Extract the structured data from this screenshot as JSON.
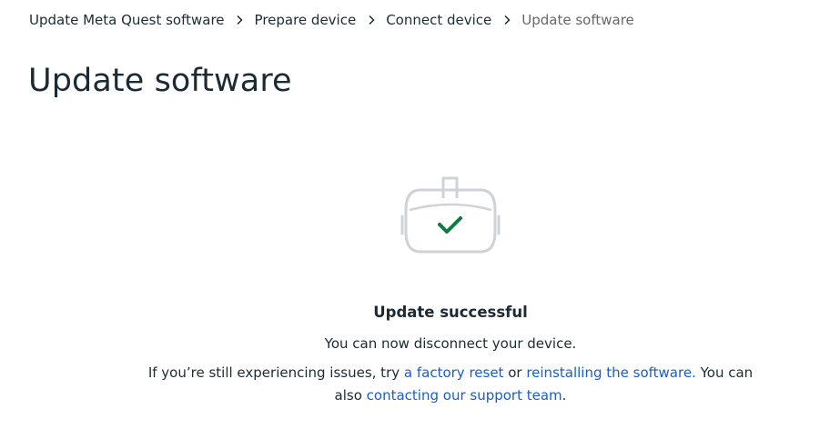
{
  "breadcrumb": {
    "items": [
      {
        "label": "Update Meta Quest software"
      },
      {
        "label": "Prepare device"
      },
      {
        "label": "Connect device"
      },
      {
        "label": "Update software"
      }
    ]
  },
  "page": {
    "title": "Update software"
  },
  "status": {
    "title": "Update successful",
    "description": "You can now disconnect your device.",
    "help": {
      "prefix": "If you’re still experiencing issues, try ",
      "link_factory_reset": "a factory reset",
      "middle": " or ",
      "link_reinstall": "reinstalling the software.",
      "after": " You can also ",
      "link_support": "contacting our support team",
      "suffix": "."
    }
  },
  "icons": {
    "breadcrumb_separator": "chevron-right-icon",
    "device": "vr-headset-icon",
    "success": "checkmark-icon"
  },
  "colors": {
    "text": "#1c2b33",
    "muted": "#65676b",
    "link": "#1a5fbf",
    "success": "#0a7d3f",
    "illustration": "#cfd3d8"
  }
}
